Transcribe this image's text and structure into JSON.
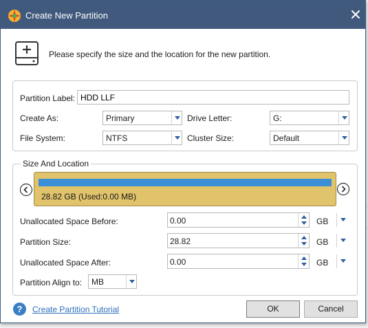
{
  "dialog": {
    "title": "Create New Partition",
    "header_text": "Please specify the size and the location for the new partition."
  },
  "form": {
    "partition_label_label": "Partition Label:",
    "partition_label_value": "HDD LLF",
    "create_as_label": "Create As:",
    "create_as_value": "Primary",
    "drive_letter_label": "Drive Letter:",
    "drive_letter_value": "G:",
    "file_system_label": "File System:",
    "file_system_value": "NTFS",
    "cluster_size_label": "Cluster Size:",
    "cluster_size_value": "Default"
  },
  "size_location": {
    "legend": "Size And Location",
    "partition_text": "28.82 GB (Used:0.00 MB)",
    "used_fraction": 1.0,
    "unallocated_before_label": "Unallocated Space Before:",
    "unallocated_before_value": "0.00",
    "partition_size_label": "Partition Size:",
    "partition_size_value": "28.82",
    "unallocated_after_label": "Unallocated Space After:",
    "unallocated_after_value": "0.00",
    "unit": "GB",
    "align_label": "Partition Align to:",
    "align_value": "MB"
  },
  "footer": {
    "tutorial_link": "Create Partition Tutorial",
    "ok_label": "OK",
    "cancel_label": "Cancel"
  },
  "colors": {
    "titlebar": "#40597d",
    "partition_block": "#e0c36a",
    "usage_bar": "#3a8fd6",
    "accent": "#2e5f9e"
  }
}
